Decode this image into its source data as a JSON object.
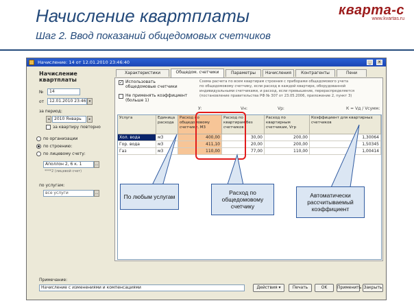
{
  "slide": {
    "title": "Начисление квартплаты",
    "subtitle": "Шаг 2.  Ввод показаний общедомовых счетчиков",
    "logo_main": "кварта-с",
    "logo_url": "www.kvartas.ru"
  },
  "window": {
    "title": "Начисление: 14 от 12.01.2010 23:46:40",
    "doc_title": "Начисление квартплаты",
    "number_label": "№",
    "number_value": "14",
    "date_label": "от",
    "date_value": "12.01.2010 23:46:40",
    "period_label": "за период:",
    "period_value": "2010 Январь",
    "check_apartment_label": "за квартиру повторно",
    "group_all_label": "по организации",
    "group_building_label": "по строению:",
    "building_value": "",
    "group_single_label": "по лицевому счету:",
    "account_value": "Аполлон 2, 6 к. 1",
    "account_hint": "****2 (лицевой счет)",
    "services_label": "по услугам:",
    "services_value": "все услуги"
  },
  "tabs": [
    {
      "label": "Характеристики"
    },
    {
      "label": "Общедом. счетчики"
    },
    {
      "label": "Параметры"
    },
    {
      "label": "Начисления"
    },
    {
      "label": "Контрагенты"
    },
    {
      "label": "Пени"
    }
  ],
  "options": {
    "opt1_label": "Использовать общедомовые счетчики",
    "opt2_label": "Не применять коэффициент (больше 1)"
  },
  "notes": {
    "line1": "Схема расчета по всем квартирам строения с приборами общедомового учета",
    "line2": "по общедомовому счетчику, если расход в каждой квартире, оборудованной",
    "line3": "индивидуальными счетчиками, и расход, если превышение, перераспределяется",
    "line4": "(постановление правительства РФ № 307 от 23.05.2006, приложение 2, пункт 3)"
  },
  "grid_meta": {
    "u_label": "У:",
    "v_label": "Vн:",
    "vr_label": "Vр:",
    "k_label": "К = Vд / Vсумм:"
  },
  "grid": {
    "columns": [
      "Услуга",
      "Единица расхода",
      "Расход по общедомовому счетчику, М3",
      "Расход по квартирам без счетчиков",
      "Расход по квартирным счетчикам, Vгр",
      "Коэффициент для квартирных счетчиков"
    ],
    "rows": [
      {
        "service": "Хол. вода",
        "unit": "м3",
        "common": "400,00",
        "noMeter": "30,00",
        "meters": "200,00",
        "coef": "1,30064"
      },
      {
        "service": "Гор. вода",
        "unit": "м3",
        "common": "411,10",
        "noMeter": "20,00",
        "meters": "200,00",
        "coef": "1,50345"
      },
      {
        "service": "Газ",
        "unit": "м3",
        "common": "110,00",
        "noMeter": "77,00",
        "meters": "110,00",
        "coef": "1,00414"
      }
    ]
  },
  "callouts": {
    "c1": "По любым услугам",
    "c2": "Расход по общедомовому счетчику",
    "c3": "Автоматически рассчитываемый коэффициент"
  },
  "footer": {
    "comment_label": "Примечание:",
    "comment_value": "Начисление с изменениями и компенсациями",
    "actions_label": "Действия ▾",
    "btn_print": "Печать",
    "btn_ok": "OK",
    "btn_apply": "Применить",
    "btn_close": "Закрыть"
  }
}
